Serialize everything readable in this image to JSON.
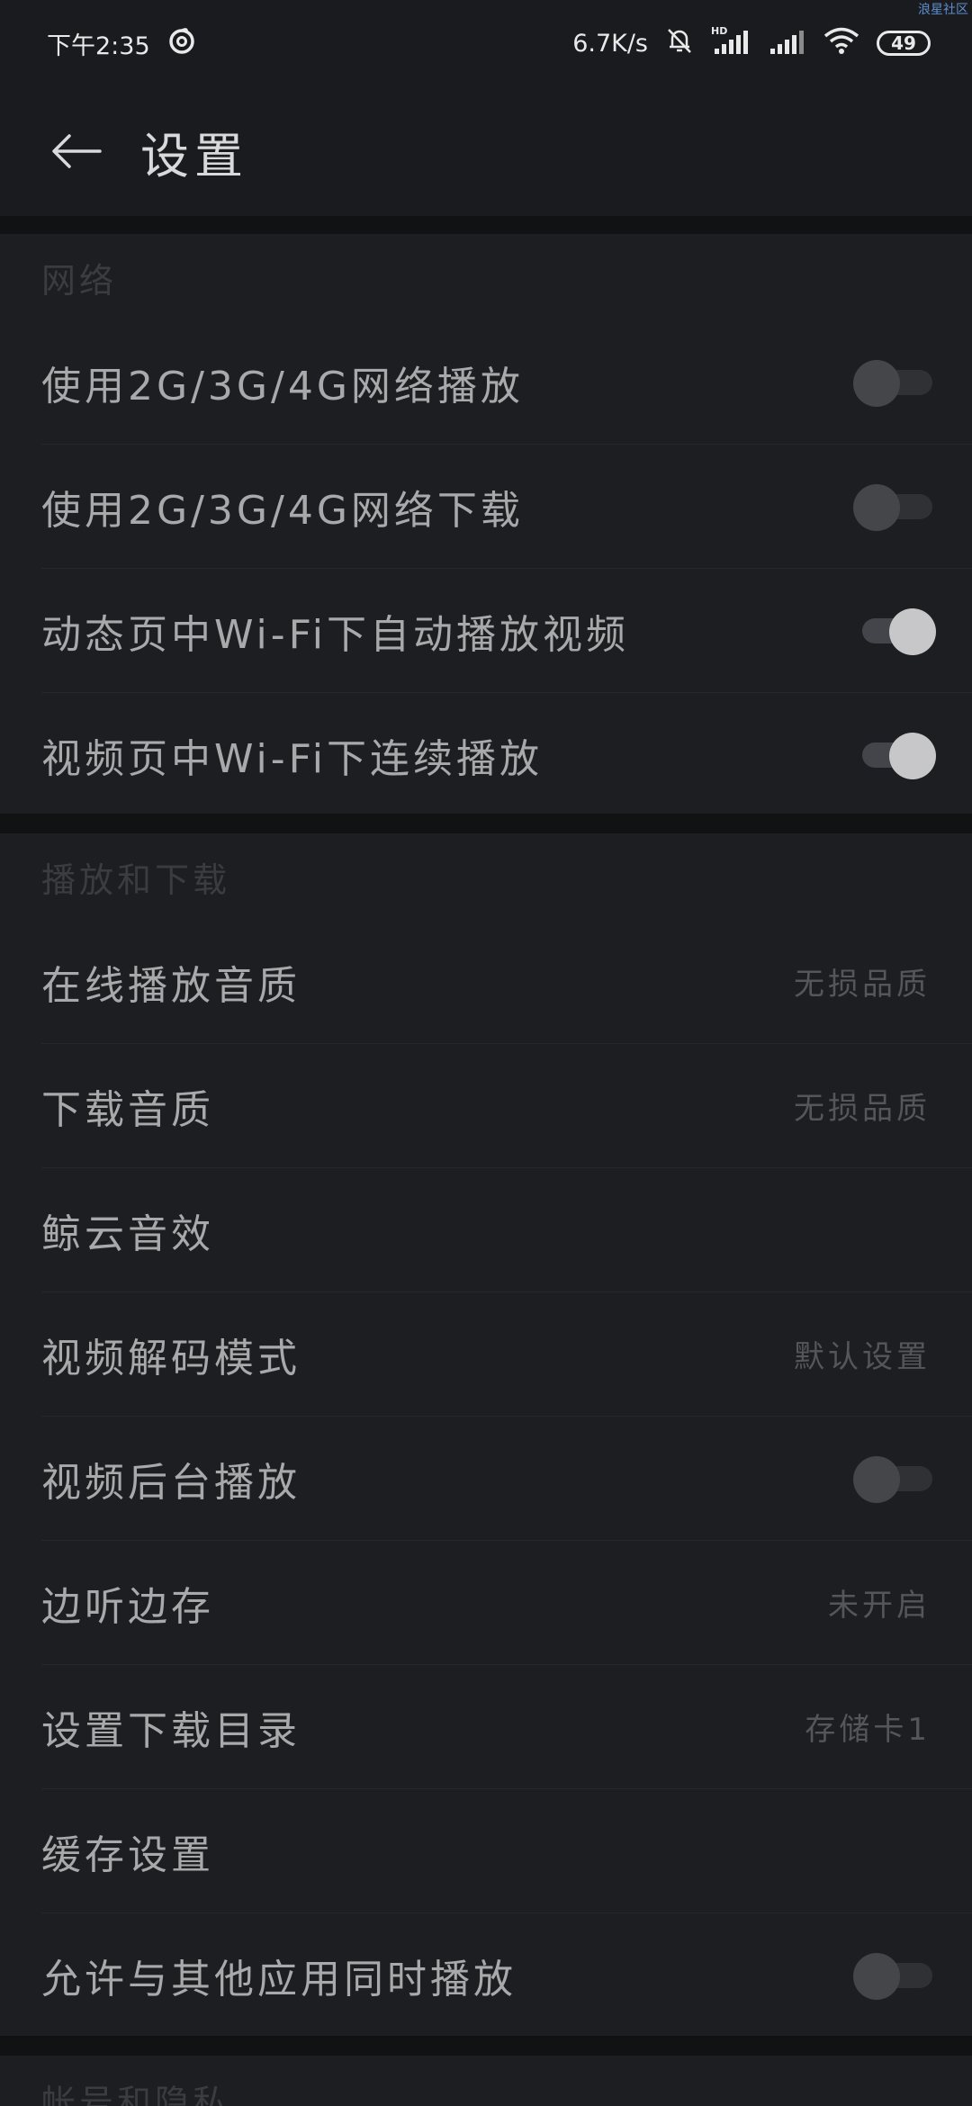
{
  "status_bar": {
    "time": "下午2:35",
    "speed": "6.7K/s",
    "battery": "49",
    "watermark": "浪星社区"
  },
  "header": {
    "title": "设置"
  },
  "sections": [
    {
      "title": "网络",
      "rows": [
        {
          "label": "使用2G/3G/4G网络播放",
          "type": "toggle",
          "state": "off"
        },
        {
          "label": "使用2G/3G/4G网络下载",
          "type": "toggle",
          "state": "off"
        },
        {
          "label": "动态页中Wi-Fi下自动播放视频",
          "type": "toggle",
          "state": "on"
        },
        {
          "label": "视频页中Wi-Fi下连续播放",
          "type": "toggle",
          "state": "on"
        }
      ]
    },
    {
      "title": "播放和下载",
      "rows": [
        {
          "label": "在线播放音质",
          "type": "value",
          "value": "无损品质"
        },
        {
          "label": "下载音质",
          "type": "value",
          "value": "无损品质"
        },
        {
          "label": "鲸云音效",
          "type": "plain"
        },
        {
          "label": "视频解码模式",
          "type": "value",
          "value": "默认设置"
        },
        {
          "label": "视频后台播放",
          "type": "toggle",
          "state": "off"
        },
        {
          "label": "边听边存",
          "type": "value",
          "value": "未开启"
        },
        {
          "label": "设置下载目录",
          "type": "value",
          "value": "存储卡1"
        },
        {
          "label": "缓存设置",
          "type": "plain"
        },
        {
          "label": "允许与其他应用同时播放",
          "type": "toggle",
          "state": "off"
        }
      ]
    },
    {
      "title": "帐号和隐私",
      "rows": []
    }
  ]
}
